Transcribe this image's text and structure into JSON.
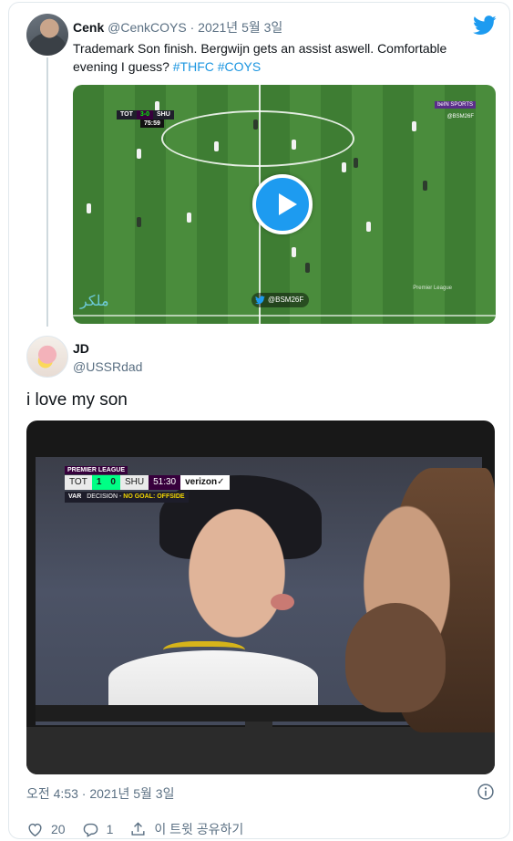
{
  "quoted_tweet": {
    "name": "Cenk",
    "handle": "@CenkCOYS",
    "separator": "·",
    "date": "2021년 5월 3일",
    "text": "Trademark Son finish. Bergwijn gets an assist aswell. Comfortable evening I guess? ",
    "hashtags": [
      "#THFC",
      "#COYS"
    ],
    "video": {
      "scorebug_home": "TOT",
      "scorebug_score": "3-0",
      "scorebug_away": "SHU",
      "scorebug_clock": "75:59",
      "broadcaster": "beIN SPORTS",
      "broadcaster_handle": "@BSM26F",
      "overlay_handle": "@BSM26F",
      "watermark": "ملكر",
      "pl_logo": "Premier League"
    }
  },
  "tweet": {
    "name": "JD",
    "handle": "@USSRdad",
    "text": "i love my son",
    "photo": {
      "league": "PREMIER LEAGUE",
      "home": "TOT",
      "home_score": "1",
      "away_score": "0",
      "away": "SHU",
      "clock": "51:30",
      "sponsor": "verizon✓",
      "var_label": "VAR",
      "var_decision": "DECISION -",
      "var_outcome": "NO GOAL: OFFSIDE"
    },
    "timestamp": "오전 4:53 · 2021년 5월 3일"
  },
  "actions": {
    "likes": "20",
    "replies": "1",
    "share_label": "이 트윗 공유하기"
  },
  "colors": {
    "link": "#1b95e0",
    "twitter_blue": "#1d9bf0",
    "muted": "#5b7083"
  },
  "icons": [
    "twitter-bird-icon",
    "play-icon",
    "info-icon",
    "heart-icon",
    "reply-icon",
    "share-icon"
  ]
}
